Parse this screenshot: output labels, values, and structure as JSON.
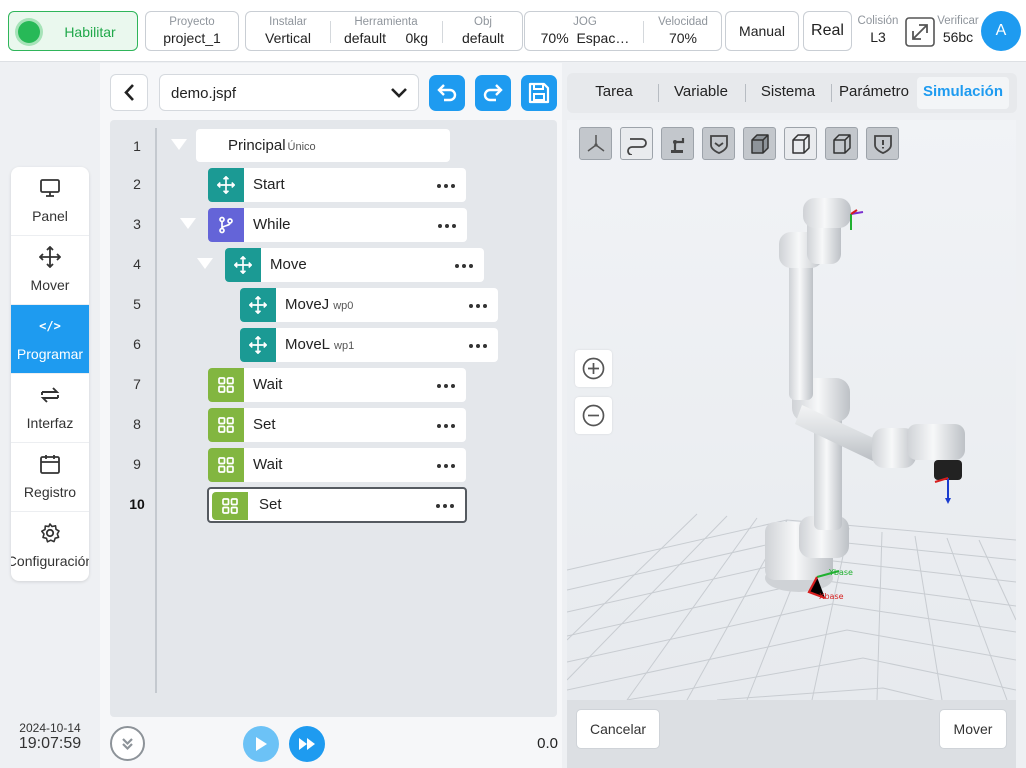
{
  "topbar": {
    "enable_label": "Habilitar",
    "project": {
      "label": "Proyecto",
      "value": "project_1"
    },
    "install": {
      "label": "Instalar",
      "value": "Vertical"
    },
    "tool": {
      "label": "Herramienta",
      "name": "default",
      "load": "0kg"
    },
    "obj": {
      "label": "Obj",
      "value": "default"
    },
    "jog": {
      "label": "JOG",
      "percent": "70%",
      "mode": "Espac…"
    },
    "speed": {
      "label": "Velocidad",
      "value": "70%"
    },
    "mode_button": "Manual",
    "real_button": "Real",
    "collision": {
      "label": "Colisión",
      "value": "L3"
    },
    "verify": {
      "label": "Verificar",
      "value": "56bc"
    },
    "avatar_initial": "A"
  },
  "sidebar": {
    "items": [
      {
        "label": "Panel",
        "icon": "monitor-icon"
      },
      {
        "label": "Mover",
        "icon": "move-icon"
      },
      {
        "label": "Programar",
        "icon": "code-icon",
        "code_glyph": "</>",
        "active": true
      },
      {
        "label": "Interfaz",
        "icon": "swap-icon"
      },
      {
        "label": "Registro",
        "icon": "calendar-icon"
      },
      {
        "label": "Configuración",
        "icon": "gear-icon"
      }
    ]
  },
  "clock": {
    "date": "2024-10-14",
    "time": "19:07:59"
  },
  "program": {
    "file_name": "demo.jspf",
    "root": {
      "title": "Principal",
      "subtitle": "Único"
    },
    "lines": [
      "1",
      "2",
      "3",
      "4",
      "5",
      "6",
      "7",
      "8",
      "9",
      "10"
    ],
    "current_line": "10",
    "nodes": [
      {
        "line": "2",
        "title": "Start",
        "subtitle": "",
        "icon": "move-icon"
      },
      {
        "line": "3",
        "title": "While",
        "subtitle": "",
        "icon": "branch-icon"
      },
      {
        "line": "4",
        "title": "Move",
        "subtitle": "",
        "icon": "move-icon"
      },
      {
        "line": "5",
        "title": "MoveJ",
        "subtitle": "wp0",
        "icon": "move-icon"
      },
      {
        "line": "6",
        "title": "MoveL",
        "subtitle": "wp1",
        "icon": "move-icon"
      },
      {
        "line": "7",
        "title": "Wait",
        "subtitle": "",
        "icon": "grid-icon"
      },
      {
        "line": "8",
        "title": "Set",
        "subtitle": "",
        "icon": "grid-icon"
      },
      {
        "line": "9",
        "title": "Wait",
        "subtitle": "",
        "icon": "grid-icon"
      },
      {
        "line": "10",
        "title": "Set",
        "subtitle": "",
        "icon": "grid-icon",
        "selected": true
      }
    ],
    "time_readout": "0.0"
  },
  "tabs": [
    {
      "label": "Tarea"
    },
    {
      "label": "Variable"
    },
    {
      "label": "Sistema"
    },
    {
      "label": "Parámetro"
    },
    {
      "label": "Simulación",
      "active": true
    }
  ],
  "simulation": {
    "view_tools": [
      "axes-view-icon",
      "path-icon",
      "robot-arm-icon",
      "shield-check-icon",
      "cube-front-icon",
      "cube-top-icon",
      "cube-side-icon",
      "shield-alert-icon"
    ],
    "axis_labels": {
      "x": "Xbase",
      "y": "Ybase"
    },
    "cancel_button": "Cancelar",
    "move_button": "Mover"
  },
  "colors": {
    "accent": "#1e9bf0",
    "enable_green": "#27b957",
    "node_teal": "#1b9a94",
    "node_purple": "#6464d8",
    "node_green": "#82b640"
  }
}
